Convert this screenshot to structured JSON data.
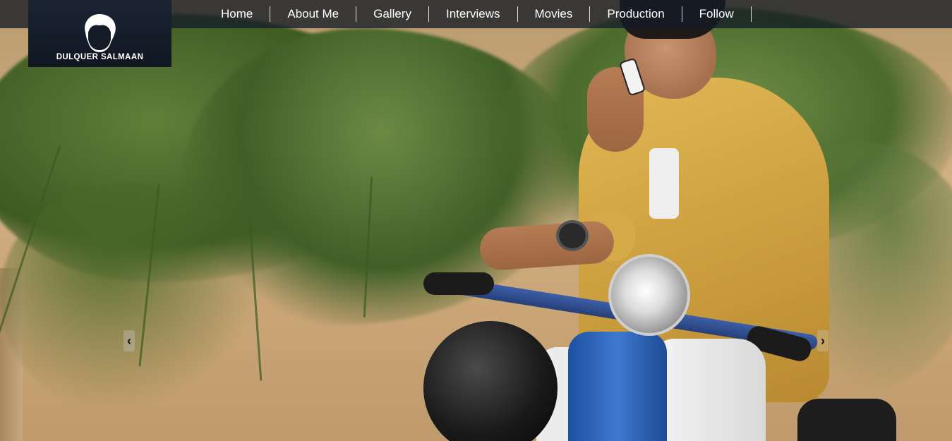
{
  "site": {
    "logo_text": "DULQUER SALMAAN",
    "logo_icon": "hair-silhouette-icon"
  },
  "nav": {
    "items": [
      {
        "label": "Home"
      },
      {
        "label": "About Me"
      },
      {
        "label": "Gallery"
      },
      {
        "label": "Interviews"
      },
      {
        "label": "Movies"
      },
      {
        "label": "Production"
      },
      {
        "label": "Follow"
      }
    ]
  },
  "slider": {
    "prev_icon": "chevron-left-icon",
    "next_icon": "chevron-right-icon",
    "prev_glyph": "‹",
    "next_glyph": "›"
  },
  "colors": {
    "topbar": "#141c26",
    "logo_bg": "#1b2432",
    "nav_text": "#ffffff"
  }
}
